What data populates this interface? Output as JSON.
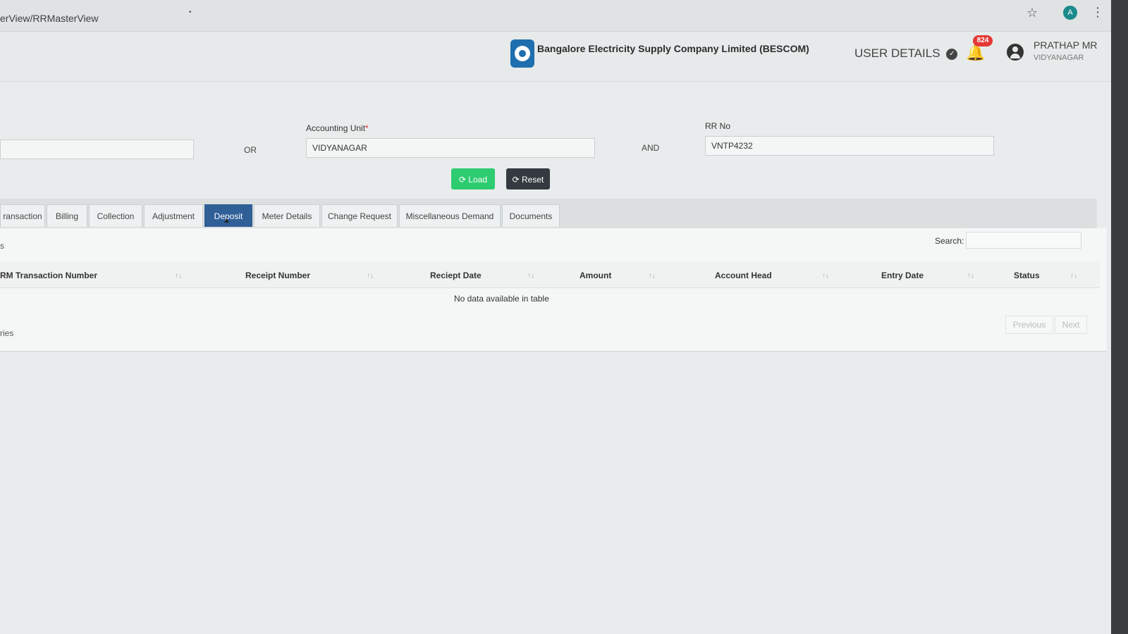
{
  "browser": {
    "url": "erView/RRMasterView",
    "dot": "•",
    "profile_initial": "A",
    "star_glyph": "☆",
    "kebab_glyph": "⋮"
  },
  "header": {
    "company_name": "Bangalore Electricity Supply Company Limited (BESCOM)",
    "user_details_label": "USER DETAILS",
    "chevron_glyph": "✓",
    "bell_glyph": "🔔",
    "notification_count": "824",
    "user_name": "PRATHAP MR",
    "user_location": "VIDYANAGAR"
  },
  "search_form": {
    "or_label": "OR",
    "accounting_unit_label": "Accounting Unit",
    "required_mark": "*",
    "accounting_unit_value": "VIDYANAGAR",
    "and_label": "AND",
    "rr_no_label": "RR No",
    "rr_no_value": "VNTP4232",
    "load_label": "⟳ Load",
    "reset_label": "⟳ Reset"
  },
  "tabs": [
    {
      "label": "ransaction"
    },
    {
      "label": "Billing"
    },
    {
      "label": "Collection"
    },
    {
      "label": "Adjustment"
    },
    {
      "label": "Deposit"
    },
    {
      "label": "Meter Details"
    },
    {
      "label": "Change Request"
    },
    {
      "label": "Miscellaneous Demand"
    },
    {
      "label": "Documents"
    }
  ],
  "active_tab": "Deposit",
  "table": {
    "search_label": "Search:",
    "left_stub": "s",
    "columns": [
      "RM Transaction Number",
      "Receipt Number",
      "Reciept Date",
      "Amount",
      "Account Head",
      "Entry Date",
      "Status"
    ],
    "sort_glyphs": [
      "↑↓",
      "↑↓",
      "↑↓",
      "↑↓",
      "↑↓",
      "↑↓",
      "↑↓"
    ],
    "rows": [],
    "empty_message": "No data available in table",
    "info_text": "ries",
    "previous_label": "Previous",
    "next_label": "Next"
  }
}
